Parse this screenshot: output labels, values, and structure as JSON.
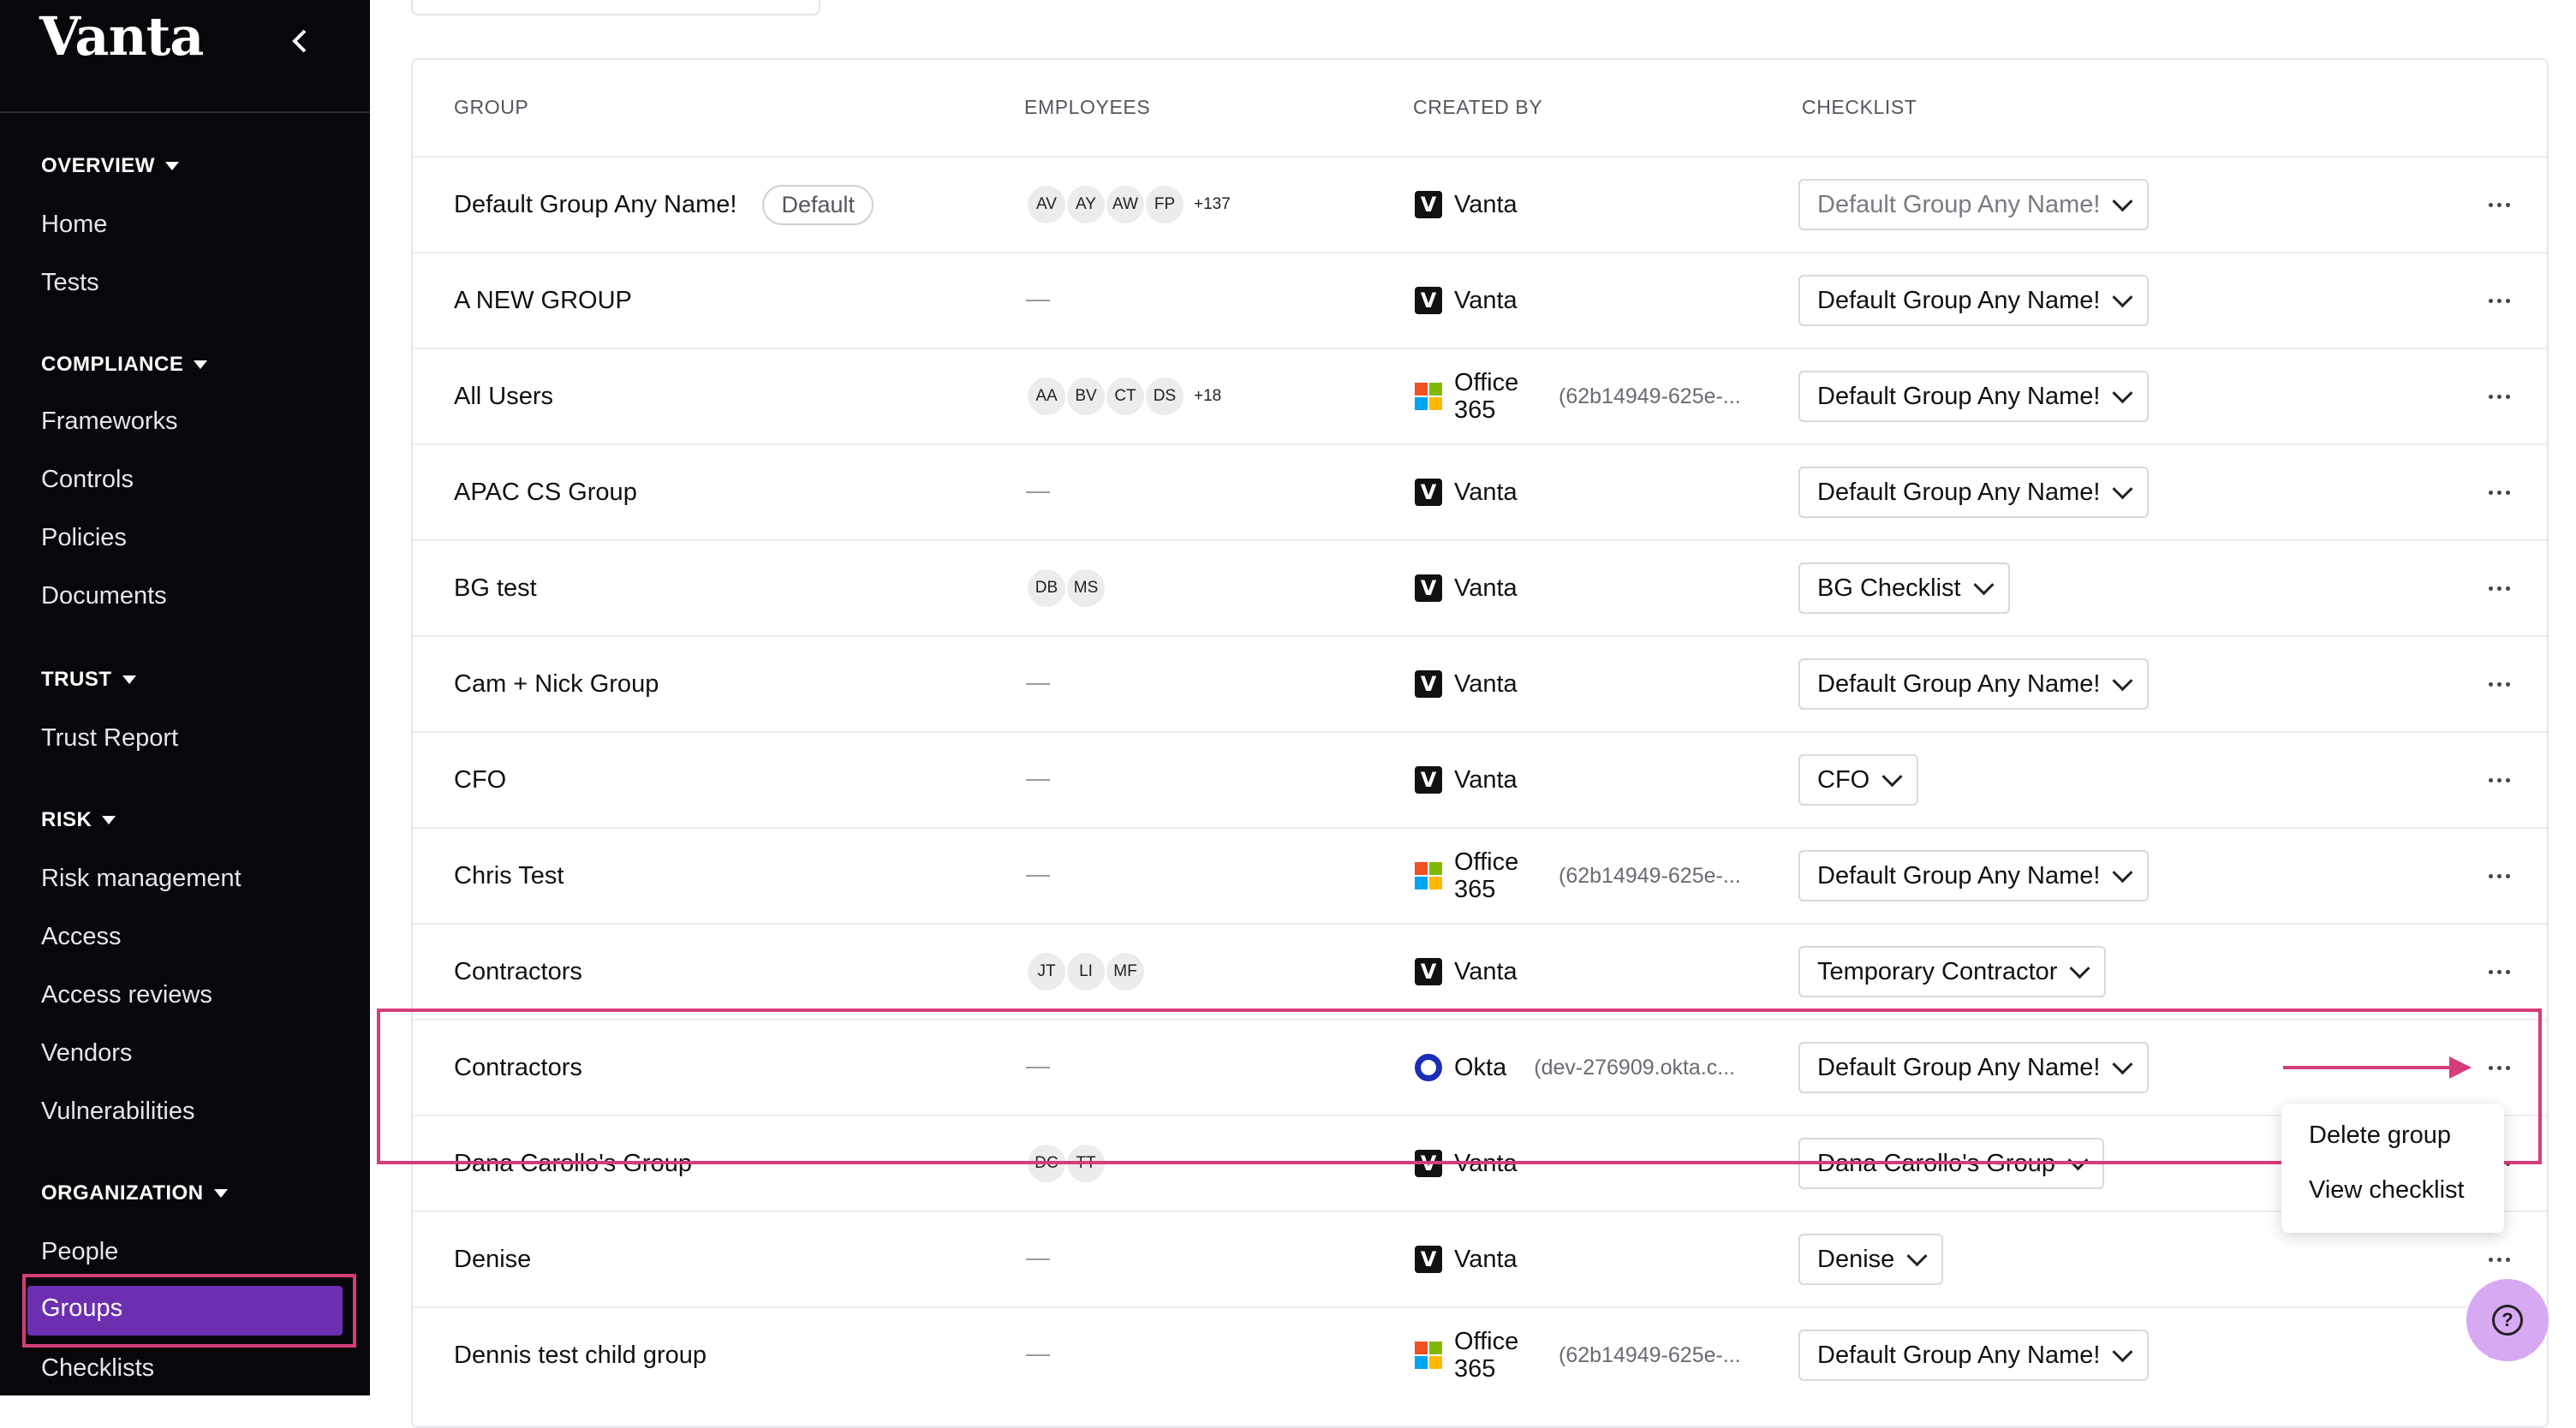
{
  "sidebar": {
    "logo": "Vanta",
    "sections": [
      {
        "title": "OVERVIEW",
        "items": [
          "Home",
          "Tests"
        ]
      },
      {
        "title": "COMPLIANCE",
        "items": [
          "Frameworks",
          "Controls",
          "Policies",
          "Documents"
        ]
      },
      {
        "title": "TRUST",
        "items": [
          "Trust Report"
        ]
      },
      {
        "title": "RISK",
        "items": [
          "Risk management",
          "Access",
          "Access reviews",
          "Vendors",
          "Vulnerabilities"
        ]
      },
      {
        "title": "ORGANIZATION",
        "items": [
          "People",
          "Groups",
          "Checklists"
        ]
      }
    ],
    "active_item": "Groups"
  },
  "table": {
    "headers": {
      "group": "GROUP",
      "employees": "EMPLOYEES",
      "created_by": "CREATED BY",
      "checklist": "CHECKLIST"
    },
    "default_badge": "Default",
    "rows": [
      {
        "group": "Default Group Any Name!",
        "default": true,
        "avatars": [
          "AV",
          "AY",
          "AW",
          "FP"
        ],
        "more": "+137",
        "creator": "Vanta",
        "creator_logo": "vanta-logo",
        "creator_sub": "",
        "checklist": "Default Group Any Name!"
      },
      {
        "group": "A NEW GROUP",
        "avatars": [],
        "more": "",
        "creator": "Vanta",
        "creator_logo": "vanta-logo",
        "creator_sub": "",
        "checklist": "Default Group Any Name!"
      },
      {
        "group": "All Users",
        "avatars": [
          "AA",
          "BV",
          "CT",
          "DS"
        ],
        "more": "+18",
        "creator": "Office 365",
        "creator_logo": "microsoft-logo",
        "creator_sub": "(62b14949-625e-...",
        "checklist": "Default Group Any Name!"
      },
      {
        "group": "APAC CS Group",
        "avatars": [],
        "more": "",
        "creator": "Vanta",
        "creator_logo": "vanta-logo",
        "creator_sub": "",
        "checklist": "Default Group Any Name!"
      },
      {
        "group": "BG test",
        "avatars": [
          "DB",
          "MS"
        ],
        "more": "",
        "creator": "Vanta",
        "creator_logo": "vanta-logo",
        "creator_sub": "",
        "checklist": "BG Checklist"
      },
      {
        "group": "Cam + Nick Group",
        "avatars": [],
        "more": "",
        "creator": "Vanta",
        "creator_logo": "vanta-logo",
        "creator_sub": "",
        "checklist": "Default Group Any Name!"
      },
      {
        "group": "CFO",
        "avatars": [],
        "more": "",
        "creator": "Vanta",
        "creator_logo": "vanta-logo",
        "creator_sub": "",
        "checklist": "CFO"
      },
      {
        "group": "Chris Test",
        "avatars": [],
        "more": "",
        "creator": "Office 365",
        "creator_logo": "microsoft-logo",
        "creator_sub": "(62b14949-625e-...",
        "checklist": "Default Group Any Name!"
      },
      {
        "group": "Contractors",
        "avatars": [
          "JT",
          "LI",
          "MF"
        ],
        "more": "",
        "creator": "Vanta",
        "creator_logo": "vanta-logo",
        "creator_sub": "",
        "checklist": "Temporary Contractor"
      },
      {
        "group": "Contractors",
        "avatars": [],
        "more": "",
        "creator": "Okta",
        "creator_logo": "okta-logo",
        "creator_sub": "(dev-276909.okta.c...",
        "checklist": "Default Group Any Name!"
      },
      {
        "group": "Dana Carollo's Group",
        "avatars": [
          "DC",
          "TT"
        ],
        "more": "",
        "creator": "Vanta",
        "creator_logo": "vanta-logo",
        "creator_sub": "",
        "checklist": "Dana Carollo's Group"
      },
      {
        "group": "Denise",
        "avatars": [],
        "more": "",
        "creator": "Vanta",
        "creator_logo": "vanta-logo",
        "creator_sub": "",
        "checklist": "Denise"
      },
      {
        "group": "Dennis test child group",
        "avatars": [],
        "more": "",
        "creator": "Office 365",
        "creator_logo": "microsoft-logo",
        "creator_sub": "(62b14949-625e-...",
        "checklist": "Default Group Any Name!"
      }
    ]
  },
  "row_menu": {
    "items": [
      "Delete group",
      "View checklist"
    ]
  },
  "colors": {
    "accent": "#6b2fb0",
    "highlight": "#d63c7a",
    "sidebar_bg": "#08080c",
    "help_bg": "#d7a9f2"
  }
}
